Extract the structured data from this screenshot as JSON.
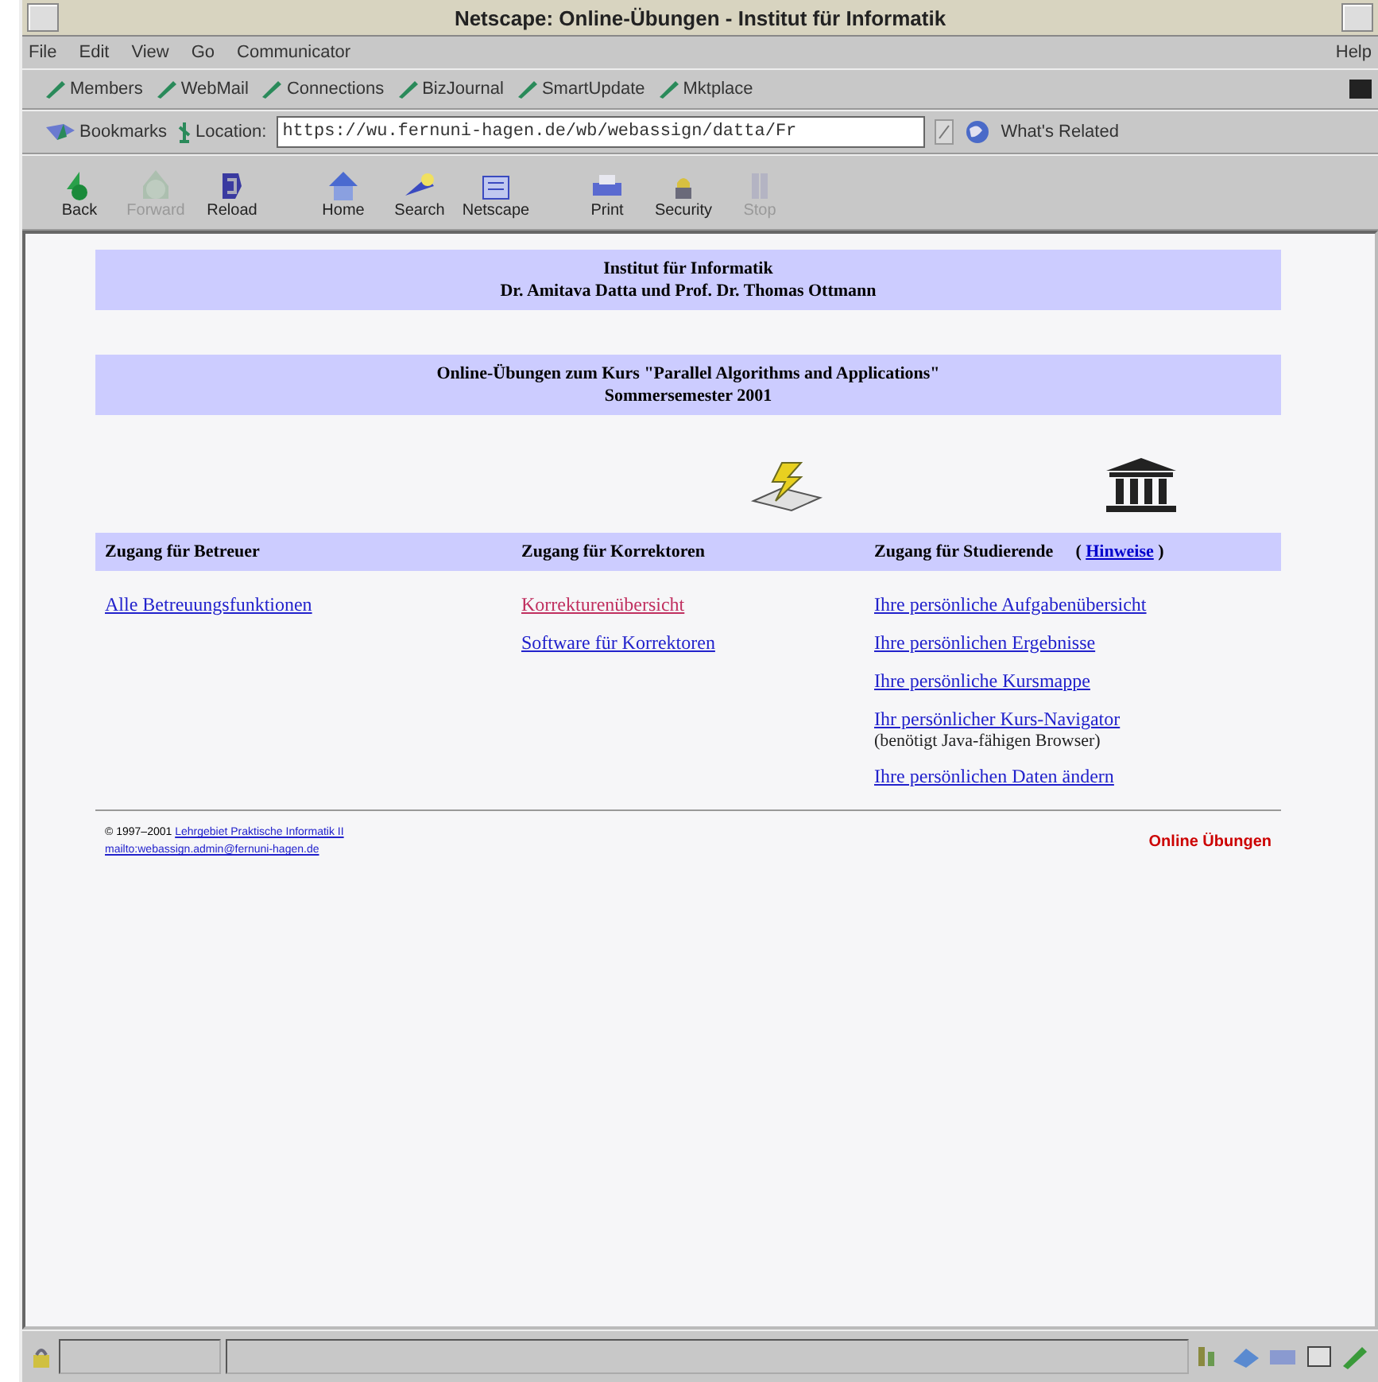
{
  "window": {
    "title": "Netscape: Online-Übungen - Institut für Informatik"
  },
  "menu": [
    {
      "label": "File"
    },
    {
      "label": "Edit"
    },
    {
      "label": "View"
    },
    {
      "label": "Go"
    },
    {
      "label": "Communicator"
    },
    {
      "label": "Help"
    }
  ],
  "personal_toolbar": [
    {
      "label": "Members"
    },
    {
      "label": "WebMail"
    },
    {
      "label": "Connections"
    },
    {
      "label": "BizJournal"
    },
    {
      "label": "SmartUpdate"
    },
    {
      "label": "Mktplace"
    }
  ],
  "location_bar": {
    "bookmarks": "Bookmarks",
    "location_label": "Location:",
    "url": "https://wu.fernuni-hagen.de/wb/webassign/datta/Fr",
    "related": "What's Related"
  },
  "nav_toolbar": [
    {
      "label": "Back",
      "kind": "back",
      "disabled": false
    },
    {
      "label": "Forward",
      "kind": "forward",
      "disabled": true
    },
    {
      "label": "Reload",
      "kind": "reload",
      "disabled": false
    },
    {
      "label": "Home",
      "kind": "home",
      "disabled": false
    },
    {
      "label": "Search",
      "kind": "search",
      "disabled": false
    },
    {
      "label": "Netscape",
      "kind": "netscape",
      "disabled": false
    },
    {
      "label": "Print",
      "kind": "print",
      "disabled": false
    },
    {
      "label": "Security",
      "kind": "security",
      "disabled": false
    },
    {
      "label": "Stop",
      "kind": "stop",
      "disabled": true
    }
  ],
  "page": {
    "banners": [
      [
        "Institut für Informatik",
        "Dr. Amitava Datta und Prof. Dr. Thomas Ottmann"
      ],
      [
        "Online-Übungen zum Kurs \"Parallel Algorithms and Applications\"",
        "Sommersemester 2001"
      ]
    ],
    "columns": [
      {
        "heading": "Zugang für Betreuer",
        "links": [
          {
            "text": "Alle Betreuungsfunktionen",
            "visited": false
          }
        ]
      },
      {
        "heading": "Zugang für Korrektoren",
        "links": [
          {
            "text": "Korrekturenübersicht",
            "visited": true
          },
          {
            "text": "Software für Korrektoren",
            "visited": false
          }
        ]
      },
      {
        "heading": "Zugang für Studierende",
        "hint": {
          "open": "(",
          "label": "Hinweise",
          "close": ")"
        },
        "links": [
          {
            "text": "Ihre persönliche Aufgabenübersicht",
            "visited": false
          },
          {
            "text": "Ihre persönlichen Ergebnisse",
            "visited": false
          },
          {
            "text": "Ihre persönliche Kursmappe",
            "visited": false
          },
          {
            "text": "Ihr persönlicher Kurs-Navigator",
            "note": "(benötigt Java-fähigen Browser)",
            "visited": false
          },
          {
            "text": "Ihre persönlichen Daten ändern",
            "visited": false
          }
        ]
      }
    ],
    "footer": {
      "copyright": "© 1997–2001",
      "links": [
        "Lehrgebiet Praktische Informatik II",
        "mailto:webassign.admin@fernuni-hagen.de"
      ],
      "brand": "Online Übungen"
    }
  }
}
